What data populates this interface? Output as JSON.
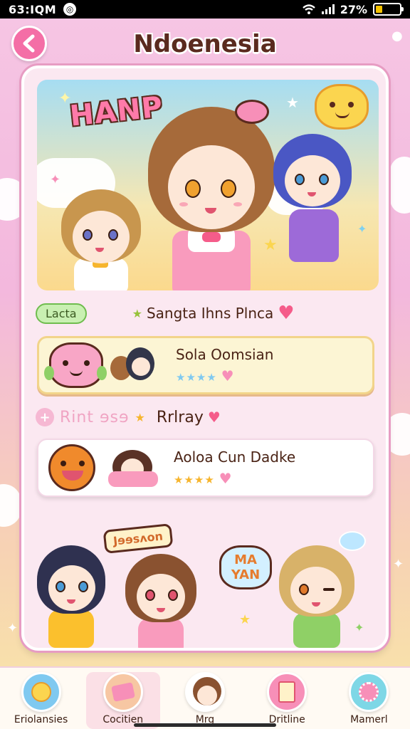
{
  "status_bar": {
    "time": "63:ⅠQM",
    "battery_text": "27%",
    "battery_level": 0.27
  },
  "header": {
    "title": "Ndoenesia"
  },
  "hero": {
    "badge_text": "HANP"
  },
  "tag_row": {
    "pill_label": "Lacta",
    "text": "Sangta Ihns Plnca"
  },
  "items": [
    {
      "title": "Sola Oomsian",
      "stars": 4
    },
    {
      "title": "Aoloa Cun Dadke",
      "stars": 4
    }
  ],
  "section": {
    "faded_text": "Rint ɘsɘ",
    "label": "Rrlray"
  },
  "scene": {
    "speech_left": "Jɘɘsʌon",
    "speech_right": "MA YAN"
  },
  "nav": [
    {
      "label": "Eriolansies",
      "color": "#7fc9f0"
    },
    {
      "label": "Cocitien",
      "color": "#f7c7a3"
    },
    {
      "label": "Mrg",
      "color": "#ffffff"
    },
    {
      "label": "Dritline",
      "color": "#f78fb8"
    },
    {
      "label": "Mamerl",
      "color": "#7ed7e6"
    }
  ],
  "colors": {
    "accent_pink": "#f46ea6",
    "title_brown": "#5a2a1e"
  }
}
